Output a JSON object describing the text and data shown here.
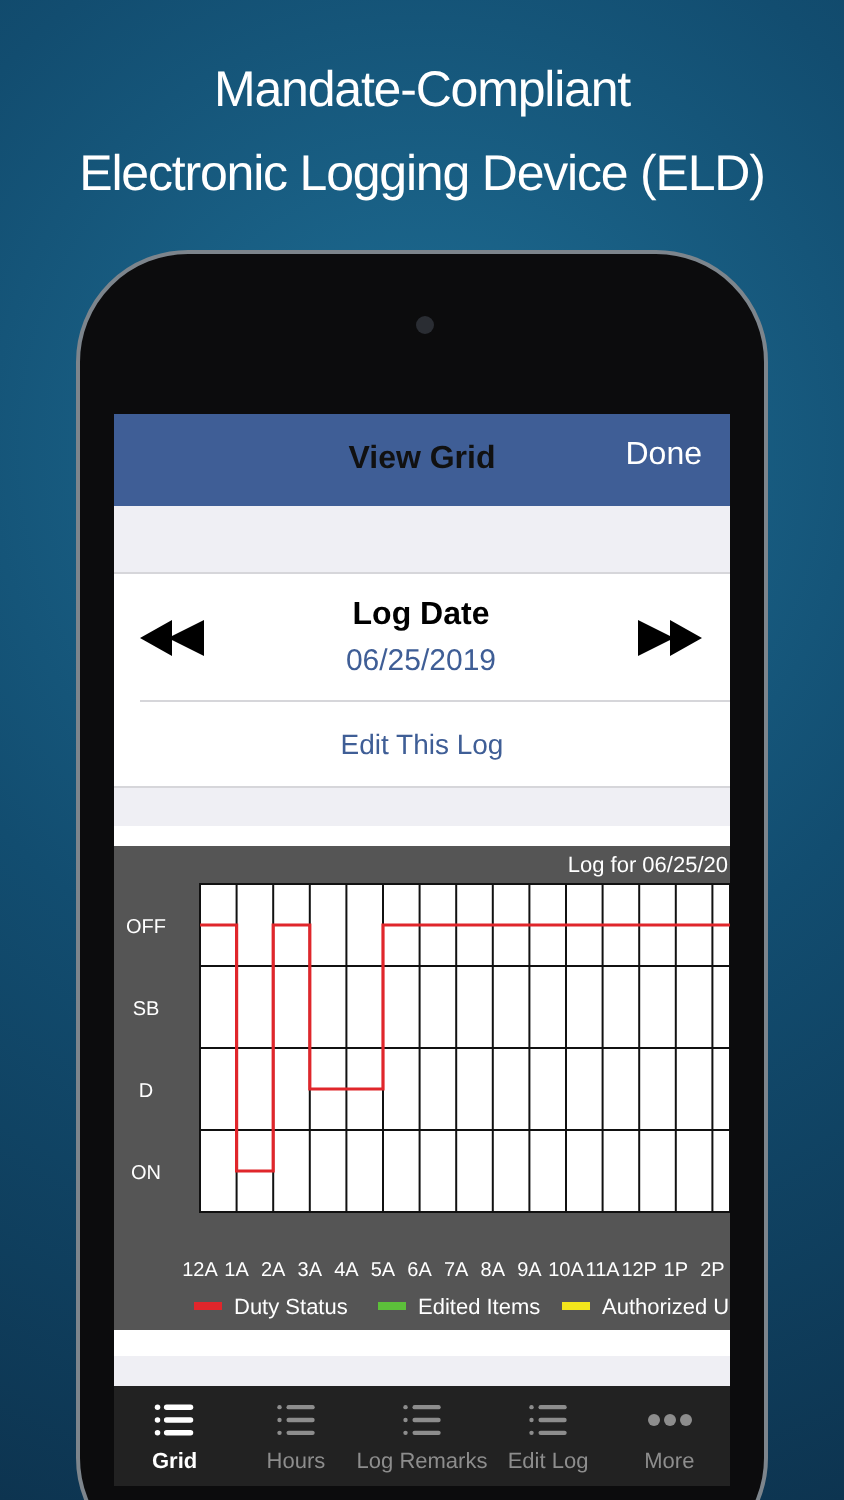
{
  "headline": {
    "lines": [
      "Mandate-Compliant",
      "Electronic Logging Device (ELD)"
    ]
  },
  "nav_bar": {
    "title": "View Grid",
    "action": "Done"
  },
  "log_date": {
    "label": "Log Date",
    "date": "06/25/2019",
    "edit_link": "Edit This Log"
  },
  "grid": {
    "title": "Log for 06/25/20",
    "rows": [
      {
        "label": "OFF",
        "kind": "off"
      },
      {
        "label": "SB",
        "kind": "sb"
      },
      {
        "label": "D",
        "kind": "d"
      },
      {
        "label": "ON",
        "kind": "on"
      }
    ],
    "hours": [
      "12A",
      "1A",
      "2A",
      "3A",
      "4A",
      "5A",
      "6A",
      "7A",
      "8A",
      "9A",
      "10A",
      "11A",
      "12P",
      "1P",
      "2P"
    ],
    "duty_log": [
      {
        "kind": "off"
      },
      {
        "kind": "on"
      },
      {
        "kind": "off"
      },
      {
        "kind": "d"
      },
      {
        "kind": "d"
      },
      {
        "kind": "off"
      },
      {
        "kind": "off"
      },
      {
        "kind": "off"
      },
      {
        "kind": "off"
      },
      {
        "kind": "off"
      },
      {
        "kind": "off"
      },
      {
        "kind": "off"
      },
      {
        "kind": "off"
      },
      {
        "kind": "off"
      },
      {
        "kind": "off"
      }
    ],
    "legend": [
      {
        "label": "Duty Status",
        "color": "#e0262b"
      },
      {
        "label": "Edited Items",
        "color": "#5cbf3a"
      },
      {
        "label": "Authorized U",
        "color": "#f2e51c"
      }
    ]
  },
  "tab_bar": [
    {
      "label": "Grid",
      "kind": "list",
      "selected": true
    },
    {
      "label": "Hours",
      "kind": "list",
      "selected": false
    },
    {
      "label": "Log Remarks",
      "kind": "list",
      "selected": false
    },
    {
      "label": "Edit Log",
      "kind": "list",
      "selected": false
    },
    {
      "label": "More",
      "kind": "more",
      "selected": false
    }
  ]
}
